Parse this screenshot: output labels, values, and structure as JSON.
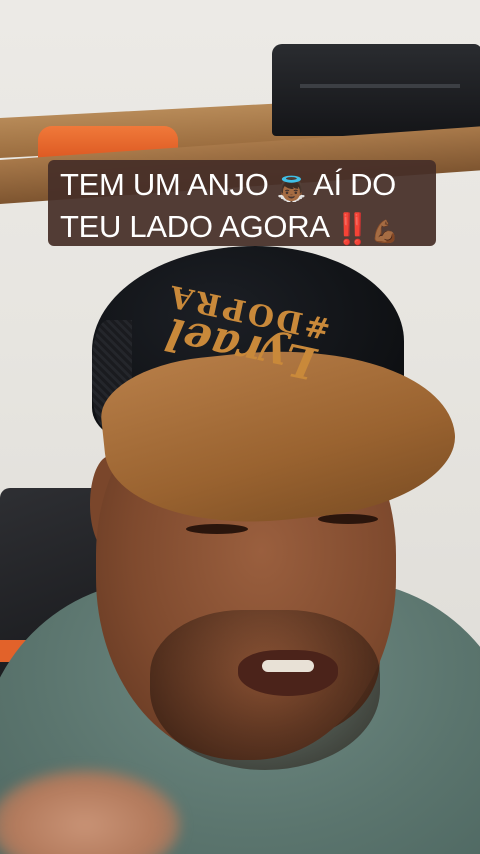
{
  "caption": {
    "line1_text": "TEM UM ANJO",
    "line1_emoji": "👼🏾",
    "line1_tail": "AÍ DO",
    "line2_text": "TEU LADO AGORA",
    "line2_emoji_1": "‼️",
    "line2_emoji_2": "💪🏾",
    "background": "#462e28",
    "text_color": "#ffffff"
  },
  "cap_logo": {
    "line1": "Lyrael",
    "line2": "#DOPRA",
    "color": "#c9893a"
  },
  "icons": {
    "angel": "angel-emoji-icon",
    "double_exclamation": "double-exclamation-icon",
    "flexed_biceps": "flexed-biceps-icon"
  }
}
